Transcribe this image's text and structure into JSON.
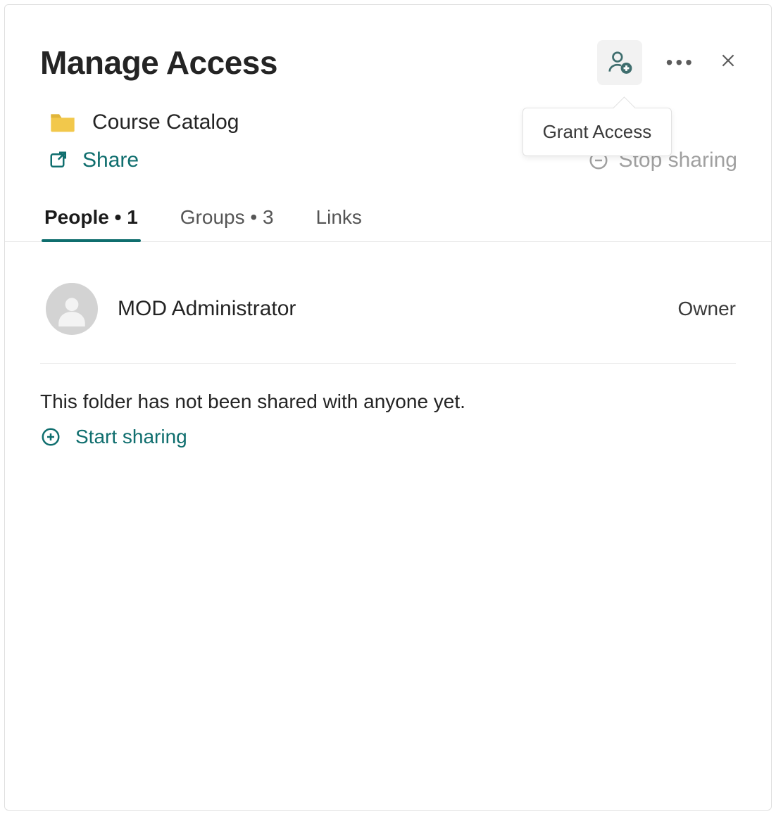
{
  "colors": {
    "accent": "#0f6e6e",
    "muted": "#a0a0a0"
  },
  "header": {
    "title": "Manage Access",
    "grant_tooltip": "Grant Access"
  },
  "item": {
    "name": "Course Catalog"
  },
  "actions": {
    "share_label": "Share",
    "stop_sharing_label": "Stop sharing",
    "start_sharing_label": "Start sharing"
  },
  "tabs": {
    "people": {
      "label": "People",
      "count": 1
    },
    "groups": {
      "label": "Groups",
      "count": 3
    },
    "links": {
      "label": "Links"
    }
  },
  "people": [
    {
      "name": "MOD Administrator",
      "role": "Owner"
    }
  ],
  "empty_message": "This folder has not been shared with anyone yet."
}
